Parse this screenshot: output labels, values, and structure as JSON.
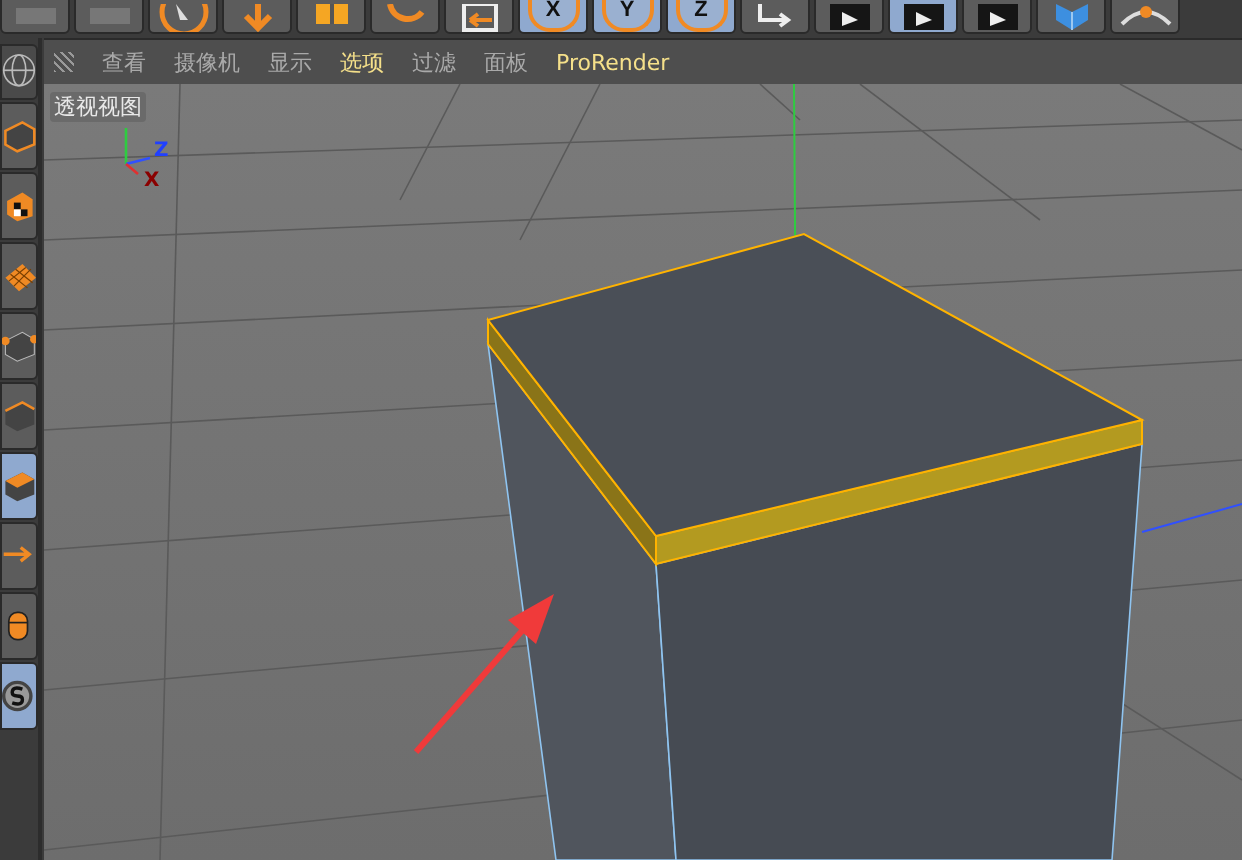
{
  "top_toolbar": [
    {
      "kind": "cut",
      "selected": false
    },
    {
      "kind": "cut",
      "selected": false
    },
    {
      "kind": "pointer",
      "selected": false
    },
    {
      "kind": "move",
      "selected": false
    },
    {
      "kind": "scale",
      "selected": false
    },
    {
      "kind": "rotate",
      "selected": false
    },
    {
      "kind": "coords",
      "selected": false
    },
    {
      "kind": "axis",
      "label": "X",
      "selected": true
    },
    {
      "kind": "axis",
      "label": "Y",
      "selected": true
    },
    {
      "kind": "axis",
      "label": "Z",
      "selected": true
    },
    {
      "kind": "world",
      "selected": false
    },
    {
      "kind": "render",
      "selected": false
    },
    {
      "kind": "render",
      "selected": true
    },
    {
      "kind": "render",
      "selected": false
    },
    {
      "kind": "cube",
      "selected": false
    },
    {
      "kind": "spline",
      "selected": false
    }
  ],
  "left_toolbar": [
    {
      "kind": "sphere",
      "selected": false
    },
    {
      "kind": "solid",
      "selected": false
    },
    {
      "kind": "texture",
      "selected": false
    },
    {
      "kind": "grid",
      "selected": false
    },
    {
      "kind": "points",
      "selected": false
    },
    {
      "kind": "edges",
      "selected": false
    },
    {
      "kind": "polygons",
      "selected": true
    },
    {
      "kind": "arrow",
      "selected": false
    },
    {
      "kind": "mouse",
      "selected": false
    },
    {
      "kind": "snap",
      "selected": true
    }
  ],
  "viewport": {
    "menu": [
      {
        "label": "查看",
        "highlighted": false
      },
      {
        "label": "摄像机",
        "highlighted": false
      },
      {
        "label": "显示",
        "highlighted": false
      },
      {
        "label": "选项",
        "highlighted": true
      },
      {
        "label": "过滤",
        "highlighted": false
      },
      {
        "label": "面板",
        "highlighted": false
      },
      {
        "label": "ProRender",
        "highlighted": true
      }
    ],
    "view_name": "透视视图",
    "axes": [
      {
        "label": "Z"
      },
      {
        "label": "X"
      }
    ]
  }
}
